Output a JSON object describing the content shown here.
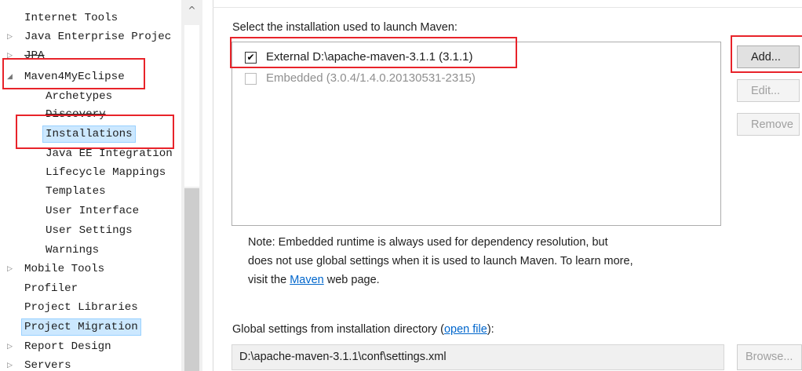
{
  "tree": {
    "items": [
      {
        "label": "Internet Tools",
        "level": 0,
        "expander": "",
        "strike": false,
        "selected": false
      },
      {
        "label": "Java Enterprise Projec",
        "level": 0,
        "expander": "▷",
        "strike": false,
        "selected": false
      },
      {
        "label": "JPA",
        "level": 0,
        "expander": "▷",
        "strike": true,
        "selected": false
      },
      {
        "label": "Maven4MyEclipse",
        "level": 0,
        "expander": "◢",
        "strike": false,
        "selected": false
      },
      {
        "label": "Archetypes",
        "level": 1,
        "expander": "",
        "strike": false,
        "selected": false
      },
      {
        "label": "Discovery",
        "level": 1,
        "expander": "",
        "strike": true,
        "selected": false
      },
      {
        "label": "Installations",
        "level": 1,
        "expander": "",
        "strike": false,
        "selected": true
      },
      {
        "label": "Java EE Integration",
        "level": 1,
        "expander": "",
        "strike": false,
        "selected": false
      },
      {
        "label": "Lifecycle Mappings",
        "level": 1,
        "expander": "",
        "strike": false,
        "selected": false
      },
      {
        "label": "Templates",
        "level": 1,
        "expander": "",
        "strike": false,
        "selected": false
      },
      {
        "label": "User Interface",
        "level": 1,
        "expander": "",
        "strike": false,
        "selected": false
      },
      {
        "label": "User Settings",
        "level": 1,
        "expander": "",
        "strike": false,
        "selected": false
      },
      {
        "label": "Warnings",
        "level": 1,
        "expander": "",
        "strike": false,
        "selected": false
      },
      {
        "label": "Mobile Tools",
        "level": 0,
        "expander": "▷",
        "strike": false,
        "selected": false
      },
      {
        "label": "Profiler",
        "level": 0,
        "expander": "",
        "strike": false,
        "selected": false
      },
      {
        "label": "Project Libraries",
        "level": 0,
        "expander": "",
        "strike": false,
        "selected": false
      },
      {
        "label": "Project Migration",
        "level": 0,
        "expander": "",
        "strike": false,
        "selected": true
      },
      {
        "label": "Report Design",
        "level": 0,
        "expander": "▷",
        "strike": false,
        "selected": false
      },
      {
        "label": "Servers",
        "level": 0,
        "expander": "▷",
        "strike": false,
        "selected": false
      }
    ],
    "scroll_up_glyph": "^"
  },
  "panel": {
    "section_label": "Select the installation used to launch Maven:",
    "installations": [
      {
        "label": "External D:\\apache-maven-3.1.1 (3.1.1)",
        "checked": true,
        "enabled": true
      },
      {
        "label": "Embedded (3.0.4/1.4.0.20130531-2315)",
        "checked": false,
        "enabled": false
      }
    ],
    "check_glyph": "✔",
    "buttons": {
      "add": "Add...",
      "edit": "Edit...",
      "remove": "Remove"
    },
    "note": {
      "line1": "Note: Embedded runtime is always used for dependency resolution, but",
      "line2": "does not use global settings when it is used to launch Maven. To learn more,",
      "line3_before": "visit the ",
      "line3_link": "Maven",
      "line3_after": " web page."
    },
    "global": {
      "label_before": "Global settings from installation directory (",
      "label_link": "open file",
      "label_after": "):",
      "path_value": "D:\\apache-maven-3.1.1\\conf\\settings.xml",
      "browse": "Browse..."
    }
  },
  "colors": {
    "highlight": "#e8232a",
    "selection": "#cce8ff",
    "link": "#0066cc"
  }
}
